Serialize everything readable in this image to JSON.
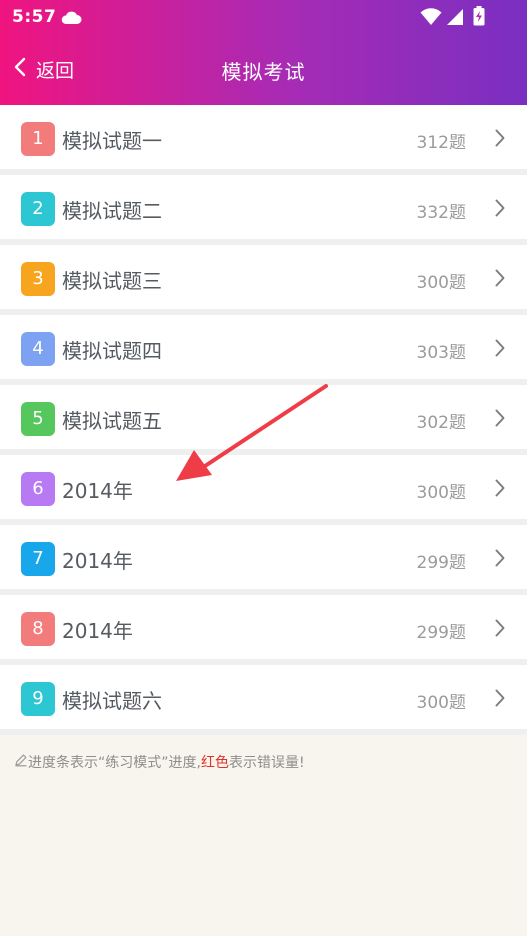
{
  "status": {
    "time": "5:57"
  },
  "nav": {
    "back_label": "返回",
    "title": "模拟考试"
  },
  "items": [
    {
      "num": "1",
      "title": "模拟试题一",
      "count": "312题",
      "color": "#f27b7b"
    },
    {
      "num": "2",
      "title": "模拟试题二",
      "count": "332题",
      "color": "#2cc7d3"
    },
    {
      "num": "3",
      "title": "模拟试题三",
      "count": "300题",
      "color": "#f7a51e"
    },
    {
      "num": "4",
      "title": "模拟试题四",
      "count": "303题",
      "color": "#7ea2f2"
    },
    {
      "num": "5",
      "title": "模拟试题五",
      "count": "302题",
      "color": "#56c75d"
    },
    {
      "num": "6",
      "title": "2014年",
      "count": "300题",
      "color": "#b77af2"
    },
    {
      "num": "7",
      "title": "2014年",
      "count": "299题",
      "color": "#19a7eb"
    },
    {
      "num": "8",
      "title": "2014年",
      "count": "299题",
      "color": "#f27b7b"
    },
    {
      "num": "9",
      "title": "模拟试题六",
      "count": "300题",
      "color": "#2cc7d3"
    }
  ],
  "footer": {
    "note_prefix": "进度条表示“练习模式”进度,",
    "note_red": "红色",
    "note_suffix": "表示错误量!"
  }
}
